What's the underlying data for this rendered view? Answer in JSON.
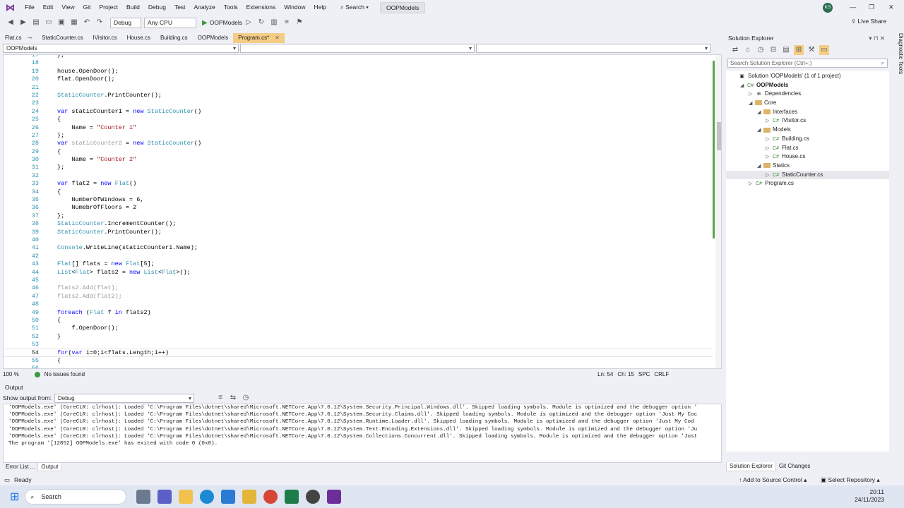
{
  "menubar": {
    "items": [
      "File",
      "Edit",
      "View",
      "Git",
      "Project",
      "Build",
      "Debug",
      "Test",
      "Analyze",
      "Tools",
      "Extensions",
      "Window",
      "Help"
    ],
    "search": "Search",
    "solution": "OOPModels",
    "avatar": "KS"
  },
  "toolbar": {
    "config": "Debug",
    "platform": "Any CPU",
    "run_target": "OOPModels",
    "live_share": "Live Share"
  },
  "tabs": [
    {
      "label": "Flat.cs",
      "pinned": true
    },
    {
      "label": "StaticCounter.cs"
    },
    {
      "label": "IVisitor.cs"
    },
    {
      "label": "House.cs"
    },
    {
      "label": "Building.cs"
    },
    {
      "label": "OOPModels"
    },
    {
      "label": "Program.cs*",
      "active": true
    }
  ],
  "nav": {
    "project": "OOPModels",
    "type": "",
    "member": ""
  },
  "editor": {
    "lines": [
      {
        "n": "17",
        "h": "};"
      },
      {
        "n": "18",
        "h": ""
      },
      {
        "n": "19",
        "h": "house.OpenDoor();"
      },
      {
        "n": "20",
        "h": "flat.OpenDoor();"
      },
      {
        "n": "21",
        "h": ""
      },
      {
        "n": "22",
        "h": "<span class='ty'>StaticCounter</span>.PrintCounter();"
      },
      {
        "n": "23",
        "h": ""
      },
      {
        "n": "24",
        "h": "<span class='kw'>var</span> staticCounter1 = <span class='kw'>new</span> <span class='ty'>StaticCounter</span>()"
      },
      {
        "n": "25",
        "h": "{"
      },
      {
        "n": "26",
        "h": "    Name = <span class='st'>\"Counter 1\"</span>"
      },
      {
        "n": "27",
        "h": "};"
      },
      {
        "n": "28",
        "h": "<span class='kw'>var</span> <span class='dim'>staticCounter2</span> = <span class='kw'>new</span> <span class='ty'>StaticCounter</span>()"
      },
      {
        "n": "29",
        "h": "{"
      },
      {
        "n": "30",
        "h": "    Name = <span class='st'>\"Counter 2\"</span>"
      },
      {
        "n": "31",
        "h": "};"
      },
      {
        "n": "32",
        "h": ""
      },
      {
        "n": "33",
        "h": "<span class='kw'>var</span> flat2 = <span class='kw'>new</span> <span class='ty'>Flat</span>()"
      },
      {
        "n": "34",
        "h": "{"
      },
      {
        "n": "35",
        "h": "    NumberOfWindows = 6,"
      },
      {
        "n": "36",
        "h": "    NumebrOfFloors = 2"
      },
      {
        "n": "37",
        "h": "};"
      },
      {
        "n": "38",
        "h": "<span class='ty'>StaticCounter</span>.IncrementCounter();"
      },
      {
        "n": "39",
        "h": "<span class='ty'>StaticCounter</span>.PrintCounter();"
      },
      {
        "n": "40",
        "h": ""
      },
      {
        "n": "41",
        "h": "<span class='ty'>Console</span>.WriteLine(staticCounter1.Name);"
      },
      {
        "n": "42",
        "h": ""
      },
      {
        "n": "43",
        "h": "<span class='ty'>Flat</span>[] flats = <span class='kw'>new</span> <span class='ty'>Flat</span>[5];"
      },
      {
        "n": "44",
        "h": "<span class='ty'>List</span>&lt;<span class='ty'>Flat</span>&gt; flats2 = <span class='kw'>new</span> <span class='ty'>List</span>&lt;<span class='ty'>Flat</span>&gt;();"
      },
      {
        "n": "45",
        "h": ""
      },
      {
        "n": "46",
        "h": "<span class='dim'>flats2.Add(flat);</span>"
      },
      {
        "n": "47",
        "h": "<span class='dim'>flats2.Add(flat2);</span>"
      },
      {
        "n": "48",
        "h": ""
      },
      {
        "n": "49",
        "h": "<span class='kw'>foreach</span> (<span class='ty'>Flat</span> f <span class='kw'>in</span> flats2)"
      },
      {
        "n": "50",
        "h": "{"
      },
      {
        "n": "51",
        "h": "    f.OpenDoor();"
      },
      {
        "n": "52",
        "h": "}"
      },
      {
        "n": "53",
        "h": ""
      },
      {
        "n": "54",
        "h": "<span class='kw'>for</span>(<span class='kw'>var</span> i=0;i&lt;flats.Length;i++)",
        "cur": true
      },
      {
        "n": "55",
        "h": "{"
      },
      {
        "n": "56",
        "h": ""
      }
    ]
  },
  "editor_status": {
    "zoom": "100 %",
    "issues": "No issues found",
    "ln": "Ln: 54",
    "ch": "Ch: 15",
    "spc": "SPC",
    "crlf": "CRLF"
  },
  "output": {
    "title": "Output",
    "show_from_label": "Show output from:",
    "source": "Debug",
    "lines": [
      "'OOPModels.exe' (CoreCLR: clrhost): Loaded 'C:\\Program Files\\dotnet\\shared\\Microsoft.NETCore.App\\7.0.12\\System.Security.Principal.Windows.dll'. Skipped loading symbols. Module is optimized and the debugger option '",
      "'OOPModels.exe' (CoreCLR: clrhost): Loaded 'C:\\Program Files\\dotnet\\shared\\Microsoft.NETCore.App\\7.0.12\\System.Security.Claims.dll'. Skipped loading symbols. Module is optimized and the debugger option 'Just My Coc",
      "'OOPModels.exe' (CoreCLR: clrhost): Loaded 'C:\\Program Files\\dotnet\\shared\\Microsoft.NETCore.App\\7.0.12\\System.Runtime.Loader.dll'. Skipped loading symbols. Module is optimized and the debugger option 'Just My Cod",
      "'OOPModels.exe' (CoreCLR: clrhost): Loaded 'C:\\Program Files\\dotnet\\shared\\Microsoft.NETCore.App\\7.0.12\\System.Text.Encoding.Extensions.dll'. Skipped loading symbols. Module is optimized and the debugger option 'Ju",
      "'OOPModels.exe' (CoreCLR: clrhost): Loaded 'C:\\Program Files\\dotnet\\shared\\Microsoft.NETCore.App\\7.0.12\\System.Collections.Concurrent.dll'. Skipped loading symbols. Module is optimized and the debugger option 'Just",
      "The program '[12852] OOPModels.exe' has exited with code 0 (0x0)."
    ]
  },
  "bottom_tabs": [
    "Error List ...",
    "Output"
  ],
  "solution_explorer": {
    "title": "Solution Explorer",
    "search_placeholder": "Search Solution Explorer (Ctrl+;)",
    "tree": [
      {
        "label": "Solution 'OOPModels' (1 of 1 project)",
        "depth": 0,
        "arrow": "",
        "icon": "sln"
      },
      {
        "label": "OOPModels",
        "depth": 1,
        "arrow": "◢",
        "icon": "C#",
        "bold": true
      },
      {
        "label": "Dependencies",
        "depth": 2,
        "arrow": "▷",
        "icon": "dep"
      },
      {
        "label": "Core",
        "depth": 2,
        "arrow": "◢",
        "icon": "folder"
      },
      {
        "label": "Interfaces",
        "depth": 3,
        "arrow": "◢",
        "icon": "folder"
      },
      {
        "label": "IVisitor.cs",
        "depth": 4,
        "arrow": "▷",
        "icon": "C#"
      },
      {
        "label": "Models",
        "depth": 3,
        "arrow": "◢",
        "icon": "folder"
      },
      {
        "label": "Building.cs",
        "depth": 4,
        "arrow": "▷",
        "icon": "C#"
      },
      {
        "label": "Flat.cs",
        "depth": 4,
        "arrow": "▷",
        "icon": "C#"
      },
      {
        "label": "House.cs",
        "depth": 4,
        "arrow": "▷",
        "icon": "C#"
      },
      {
        "label": "Statics",
        "depth": 3,
        "arrow": "◢",
        "icon": "folder"
      },
      {
        "label": "StaticCounter.cs",
        "depth": 4,
        "arrow": "▷",
        "icon": "C#",
        "selected": true
      },
      {
        "label": "Program.cs",
        "depth": 2,
        "arrow": "▷",
        "icon": "C#"
      }
    ],
    "bottom_tabs": [
      "Solution Explorer",
      "Git Changes"
    ]
  },
  "diagnostic_tab": "Diagnostic Tools",
  "statusbar": {
    "ready": "Ready",
    "source_control": "Add to Source Control",
    "repo": "Select Repository"
  },
  "taskbar": {
    "search": "Search",
    "time": "20:11",
    "date": "24/11/2023"
  },
  "colors": {
    "accent": "#6c2e99",
    "active_tab": "#f5cc84",
    "keyword": "#0000ff",
    "type": "#2b91af",
    "string": "#a31515"
  }
}
